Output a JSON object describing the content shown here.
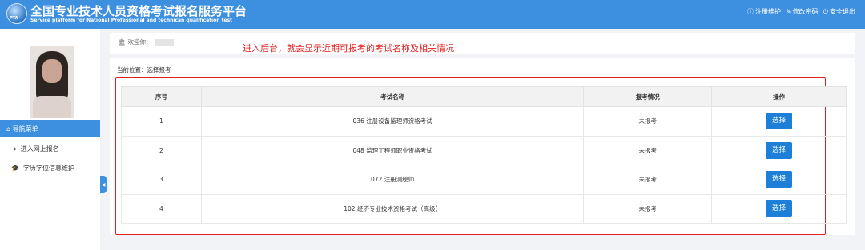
{
  "header": {
    "title": "全国专业技术人员资格考试报名服务平台",
    "subtitle": "Service platform for National Professional and technican qualification test",
    "links": [
      {
        "icon": "info-icon",
        "label": "注册维护"
      },
      {
        "icon": "edit-icon",
        "label": "修改密码"
      },
      {
        "icon": "power-icon",
        "label": "安全退出"
      }
    ]
  },
  "sidebar": {
    "nav_header": "导航菜单",
    "items": [
      {
        "icon": "sign-in-icon",
        "label": "进入网上报名"
      },
      {
        "icon": "graduation-cap-icon",
        "label": "学历学位信息维护"
      }
    ]
  },
  "welcome": {
    "label": "欢迎你："
  },
  "annotation": "进入后台，就会显示近期可报考的考试名称及相关情况",
  "breadcrumb": "当前位置：选择报考",
  "table": {
    "headers": [
      "序号",
      "考试名称",
      "报考情况",
      "操作"
    ],
    "rows": [
      {
        "no": "1",
        "name": "036 注册设备监理师资格考试",
        "status": "未报考",
        "action": "选择"
      },
      {
        "no": "2",
        "name": "048 监理工程师职业资格考试",
        "status": "未报考",
        "action": "选择"
      },
      {
        "no": "3",
        "name": "072 注册测绘师",
        "status": "未报考",
        "action": "选择"
      },
      {
        "no": "4",
        "name": "102 经济专业技术资格考试（高级）",
        "status": "未报考",
        "action": "选择"
      }
    ]
  },
  "colors": {
    "primary": "#3d8fe0",
    "button": "#1e7fd8",
    "annotation": "#e02020"
  }
}
